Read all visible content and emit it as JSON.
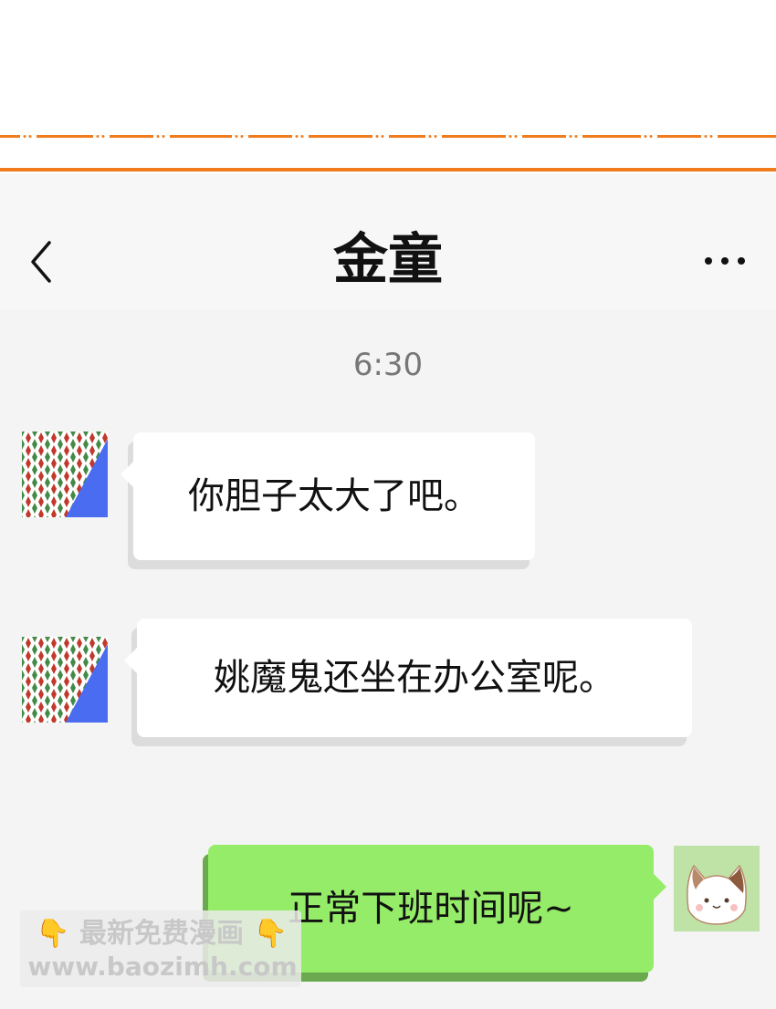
{
  "header": {
    "title": "金童",
    "back_icon": "chevron-left-icon",
    "more_icon": "ellipsis-icon"
  },
  "chat": {
    "timestamp": "6:30",
    "messages": [
      {
        "sender": "contact",
        "text": "你胆子太大了吧。",
        "avatar_icon": "diamond-pattern-avatar"
      },
      {
        "sender": "contact",
        "text": "姚魔鬼还坐在办公室呢。",
        "avatar_icon": "diamond-pattern-avatar"
      },
      {
        "sender": "self",
        "text": "正常下班时间呢~",
        "avatar_icon": "cat-avatar"
      }
    ]
  },
  "watermark": {
    "line1": "最新免费漫画",
    "line2": "www.baozimh.com",
    "hand_icon": "pointing-down-hand-icon"
  },
  "colors": {
    "accent_orange": "#f07c1e",
    "self_bubble": "#95ec69",
    "contact_bubble": "#ffffff",
    "avatar_blue": "#4a6cf0",
    "avatar_red": "#c0392b",
    "avatar_green": "#2e7d32"
  }
}
